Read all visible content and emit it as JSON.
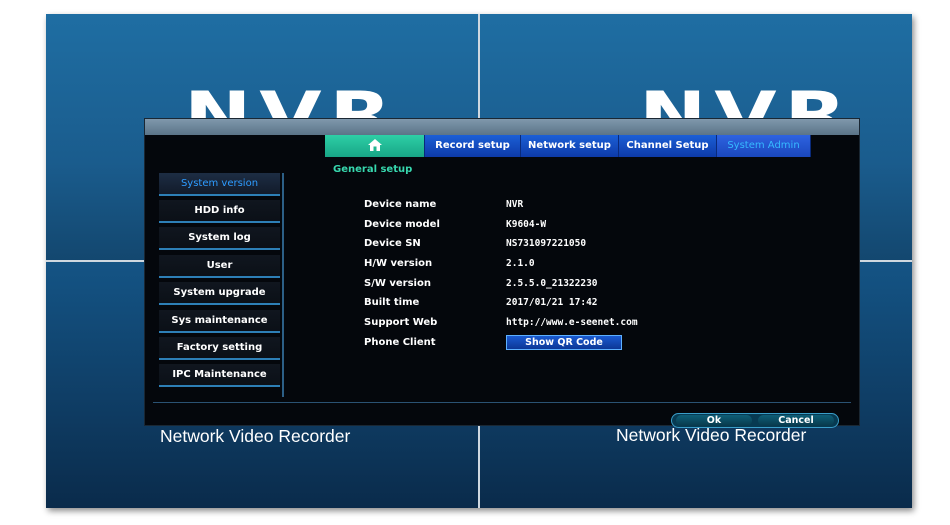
{
  "background": {
    "watermark_text": "NVR",
    "label_left": "Network Video Recorder",
    "label_right": "Network Video Recorder"
  },
  "tabs": [
    {
      "id": "home",
      "label": "",
      "icon": "home-icon"
    },
    {
      "id": "record",
      "label": "Record setup"
    },
    {
      "id": "network",
      "label": "Network setup"
    },
    {
      "id": "channel",
      "label": "Channel Setup"
    },
    {
      "id": "admin",
      "label": "System Admin",
      "selected": true
    }
  ],
  "section_title": "General setup",
  "sidebar": {
    "items": [
      {
        "label": "System version",
        "active": true
      },
      {
        "label": "HDD info"
      },
      {
        "label": "System log"
      },
      {
        "label": "User"
      },
      {
        "label": "System upgrade"
      },
      {
        "label": "Sys maintenance"
      },
      {
        "label": "Factory setting"
      },
      {
        "label": "IPC Maintenance"
      }
    ]
  },
  "info": {
    "device_name": {
      "label": "Device name",
      "value": "NVR"
    },
    "device_model": {
      "label": "Device model",
      "value": "K9604-W"
    },
    "device_sn": {
      "label": "Device SN",
      "value": "NS731097221050"
    },
    "hw_version": {
      "label": "H/W version",
      "value": "2.1.0"
    },
    "sw_version": {
      "label": "S/W version",
      "value": "2.5.5.0_21322230"
    },
    "built_time": {
      "label": "Built time",
      "value": "2017/01/21 17:42"
    },
    "support_web": {
      "label": "Support Web",
      "value": "http://www.e-seenet.com"
    },
    "phone_client": {
      "label": "Phone Client",
      "button": "Show QR Code"
    }
  },
  "footer": {
    "ok": "Ok",
    "cancel": "Cancel"
  },
  "colors": {
    "tab_blue": "#1b5fd6",
    "tab_home": "#2ecfa6",
    "section_green": "#37d7ae",
    "active_blue": "#2e9cff"
  }
}
